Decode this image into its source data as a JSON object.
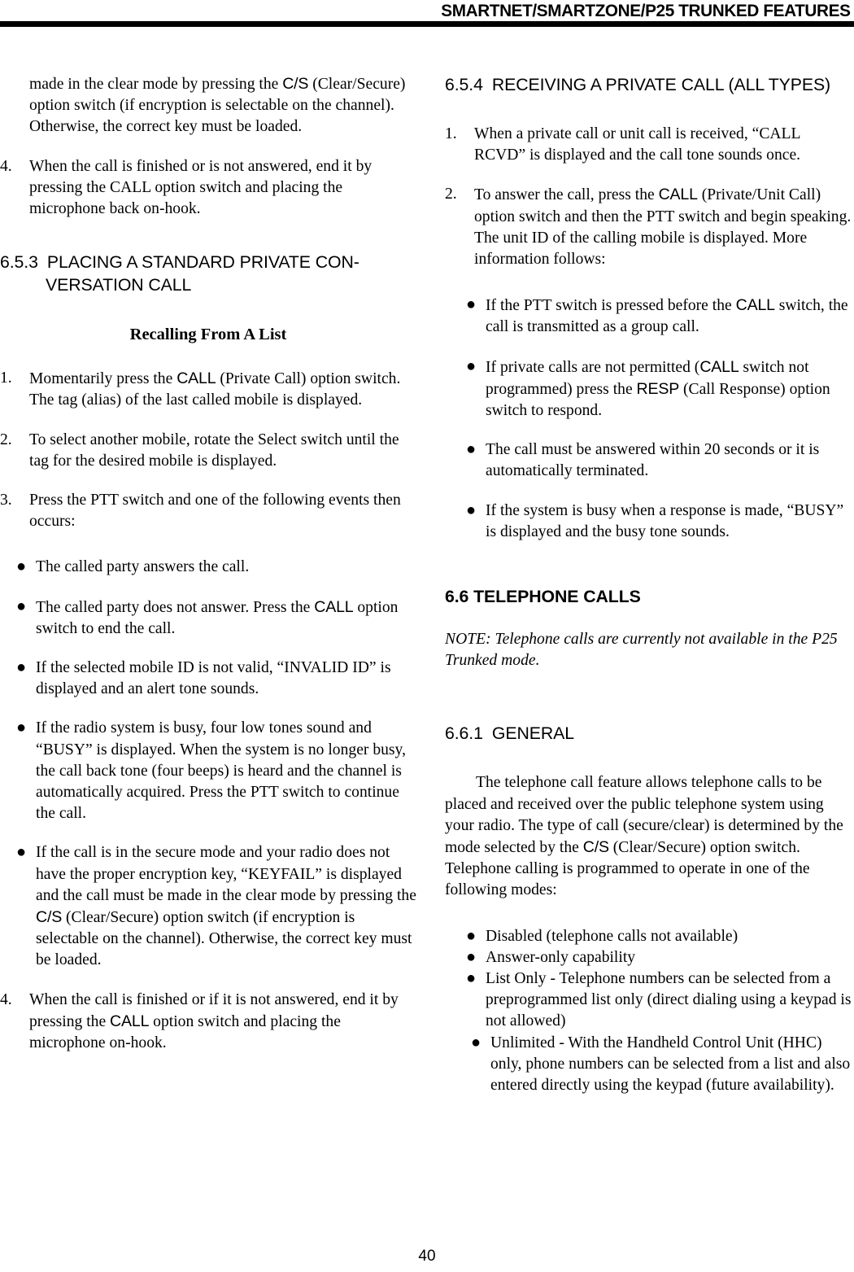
{
  "header": {
    "title": "SMARTNET/SMARTZONE/P25 TRUNKED FEATURES"
  },
  "footer": {
    "page_number": "40"
  },
  "left_column": {
    "continuation_paragraph": {
      "t1": "made in the clear mode by pressing the ",
      "ctl1": "C/S",
      "t2": " (Clear/Secure) option switch (if encryption is selectable on the channel). Otherwise, the correct key must be loaded."
    },
    "item_4": {
      "number": "4.",
      "text": "When the call is finished or is not answered, end it by pressing the CALL option switch and placing the microphone back on-hook."
    },
    "heading_653": {
      "number": "6.5.3",
      "title": "PLACING A STANDARD PRIVATE CON-VERSATION CALL"
    },
    "subheading": "Recalling From A List",
    "item_1": {
      "number": "1.",
      "t1": "Momentarily press the ",
      "ctl1": "CALL",
      "t2": " (Private Call) option switch. The tag (alias) of the last called mobile is displayed."
    },
    "item_2": {
      "number": "2.",
      "text": "To select another mobile, rotate the Select switch until the tag for the desired mobile is displayed."
    },
    "item_3": {
      "number": "3.",
      "text": "Press the PTT switch and one of the following events then occurs:"
    },
    "bullets": [
      {
        "text": "The called party answers the call."
      },
      {
        "t1": "The called party does not answer. Press the ",
        "ctl1": "CALL",
        "t2": " option switch to end the call."
      },
      {
        "text": "If the selected mobile ID is not valid, “INVALID ID” is displayed and an alert tone sounds."
      },
      {
        "text": "If the radio system is busy, four low tones sound and “BUSY” is displayed. When the system is no longer busy, the call back tone (four beeps) is heard and the channel is automatically acquired. Press the PTT switch to continue the call."
      },
      {
        "t1": "If the call is in the secure mode and your radio does not have the proper encryption key, “KEYFAIL” is displayed and the call must be made in the clear mode by pressing the ",
        "ctl1": "C/S",
        "t2": " (Clear/Secure) option switch (if encryption is selectable on the channel). Otherwise, the correct key must be loaded."
      }
    ],
    "item_4b": {
      "number": "4.",
      "t1": "When the call is finished or if it is not answered, end it by pressing the ",
      "ctl1": "CALL",
      "t2": " option switch and placing the microphone on-hook."
    }
  },
  "right_column": {
    "heading_654": {
      "number": "6.5.4",
      "title": "RECEIVING A PRIVATE CALL (ALL TYPES)"
    },
    "item_1": {
      "number": "1.",
      "text": "When a private call or unit call is received, “CALL RCVD” is displayed and the call tone sounds once."
    },
    "item_2": {
      "number": "2.",
      "t1": "To answer the call, press the ",
      "ctl1": "CALL",
      "t2": " (Private/Unit Call) option switch and then the PTT switch and begin speaking. The unit ID of the calling mobile is displayed. More information follows:"
    },
    "bullets": [
      {
        "t1": "If the PTT switch is pressed before the ",
        "ctl1": "CALL",
        "t2": " switch, the call is transmitted as a group call."
      },
      {
        "t1": "If private calls are not permitted (",
        "ctl1": "CALL",
        "t2": " switch not programmed) press the ",
        "ctl2": "RESP",
        "t3": " (Call Response) option switch to respond."
      },
      {
        "text": "The call must be answered within 20 seconds or it is automatically terminated."
      },
      {
        "text": "If the system is busy when a response is made, “BUSY” is displayed and the busy tone sounds."
      }
    ],
    "heading_66": {
      "number": "6.6",
      "title": "TELEPHONE CALLS"
    },
    "note": "NOTE: Telephone calls are currently not available in the P25 Trunked mode.",
    "heading_661": {
      "number": "6.6.1",
      "title": "GENERAL"
    },
    "general_paragraph": {
      "t1": "The telephone call feature allows telephone calls to be placed and received over the public telephone system using your radio. The type of call (secure/clear) is determined by the mode selected by the ",
      "ctl1": "C/S",
      "t2": " (Clear/Secure) option switch. Telephone calling is programmed to operate in one of the following modes:"
    },
    "mode_bullets": [
      {
        "text": "Disabled (telephone calls not available)"
      },
      {
        "text": "Answer-only capability"
      },
      {
        "text": "List Only - Telephone numbers can be selected from a preprogrammed list only (direct dialing using a keypad is not allowed)"
      },
      {
        "text": "Unlimited - With the Handheld Control Unit (HHC) only, phone numbers can be selected from a list and also entered directly using the keypad (future availability)."
      }
    ]
  }
}
